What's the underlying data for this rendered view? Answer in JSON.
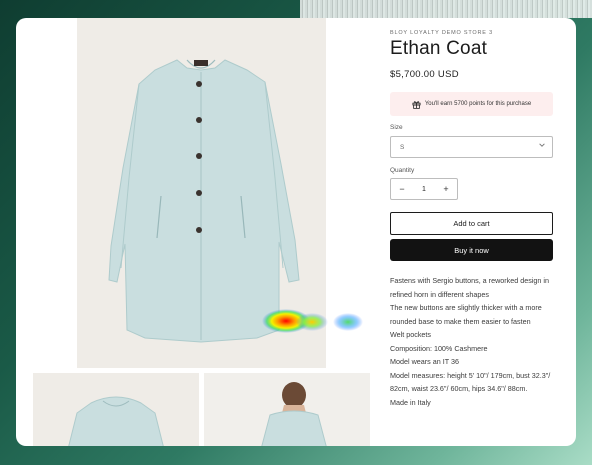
{
  "product": {
    "vendor": "BLOY LOYALTY DEMO STORE 3",
    "title": "Ethan Coat",
    "price": "$5,700.00 USD"
  },
  "loyalty": {
    "icon": "gift-icon",
    "text": "You'll earn 5700 points for this purchase"
  },
  "size": {
    "label": "Size",
    "value": "S",
    "icon": "chevron-down-icon"
  },
  "quantity": {
    "label": "Quantity",
    "minus": "−",
    "value": "1",
    "plus": "+"
  },
  "buttons": {
    "add_to_cart": "Add to cart",
    "buy_now": "Buy it now"
  },
  "description": [
    "Fastens with Sergio buttons, a reworked design in refined horn in different shapes",
    "The new buttons are slightly thicker with a more rounded base to make them easier to fasten",
    "Welt pockets",
    "Composition: 100% Cashmere",
    "Model wears an IT 36",
    "Model measures: height 5' 10\"/ 179cm, bust 32.3\"/ 82cm, waist 23.6\"/ 60cm, hips 34.6\"/ 88cm.",
    "Made in Italy"
  ],
  "colors": {
    "coat": "#c9dedf",
    "image_bg": "#efece7",
    "buy_button": "#121212",
    "loyalty_bg": "#fdeeee"
  }
}
